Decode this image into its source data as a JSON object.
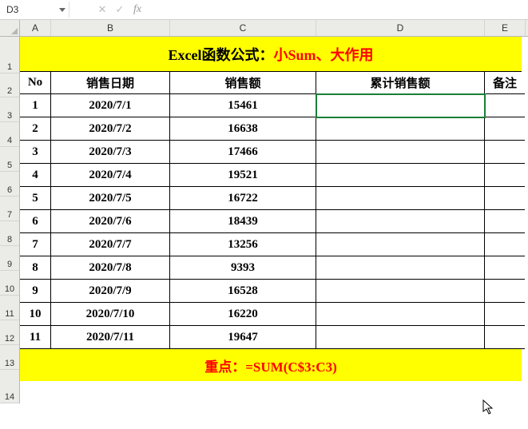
{
  "namebox": "D3",
  "colHeaders": {
    "A": "A",
    "B": "B",
    "C": "C",
    "D": "D",
    "E": "E"
  },
  "rowHeaders": [
    "1",
    "2",
    "3",
    "4",
    "5",
    "6",
    "7",
    "8",
    "9",
    "10",
    "11",
    "12",
    "13",
    "14"
  ],
  "title": {
    "prefix": "Excel函数公式：",
    "red": "小Sum、大作用"
  },
  "headers": {
    "no": "No",
    "date": "销售日期",
    "amount": "销售额",
    "cum": "累计销售额",
    "note": "备注"
  },
  "rows": [
    {
      "no": "1",
      "date": "2020/7/1",
      "amount": "15461"
    },
    {
      "no": "2",
      "date": "2020/7/2",
      "amount": "16638"
    },
    {
      "no": "3",
      "date": "2020/7/3",
      "amount": "17466"
    },
    {
      "no": "4",
      "date": "2020/7/4",
      "amount": "19521"
    },
    {
      "no": "5",
      "date": "2020/7/5",
      "amount": "16722"
    },
    {
      "no": "6",
      "date": "2020/7/6",
      "amount": "18439"
    },
    {
      "no": "7",
      "date": "2020/7/7",
      "amount": "13256"
    },
    {
      "no": "8",
      "date": "2020/7/8",
      "amount": "9393"
    },
    {
      "no": "9",
      "date": "2020/7/9",
      "amount": "16528"
    },
    {
      "no": "10",
      "date": "2020/7/10",
      "amount": "16220"
    },
    {
      "no": "11",
      "date": "2020/7/11",
      "amount": "19647"
    }
  ],
  "footer": {
    "label": "重点：",
    "formula": "=SUM(C$3:C3)"
  },
  "heights": {
    "title": 44,
    "hd": 28,
    "row": 29,
    "foot": 40
  },
  "chart_data": {
    "type": "table",
    "title": "Excel函数公式：小Sum、大作用",
    "columns": [
      "No",
      "销售日期",
      "销售额",
      "累计销售额",
      "备注"
    ],
    "data": [
      [
        1,
        "2020/7/1",
        15461,
        null,
        null
      ],
      [
        2,
        "2020/7/2",
        16638,
        null,
        null
      ],
      [
        3,
        "2020/7/3",
        17466,
        null,
        null
      ],
      [
        4,
        "2020/7/4",
        19521,
        null,
        null
      ],
      [
        5,
        "2020/7/5",
        16722,
        null,
        null
      ],
      [
        6,
        "2020/7/6",
        18439,
        null,
        null
      ],
      [
        7,
        "2020/7/7",
        13256,
        null,
        null
      ],
      [
        8,
        "2020/7/8",
        9393,
        null,
        null
      ],
      [
        9,
        "2020/7/9",
        16528,
        null,
        null
      ],
      [
        10,
        "2020/7/10",
        16220,
        null,
        null
      ],
      [
        11,
        "2020/7/11",
        19647,
        null,
        null
      ]
    ],
    "footer_formula": "=SUM(C$3:C3)"
  }
}
